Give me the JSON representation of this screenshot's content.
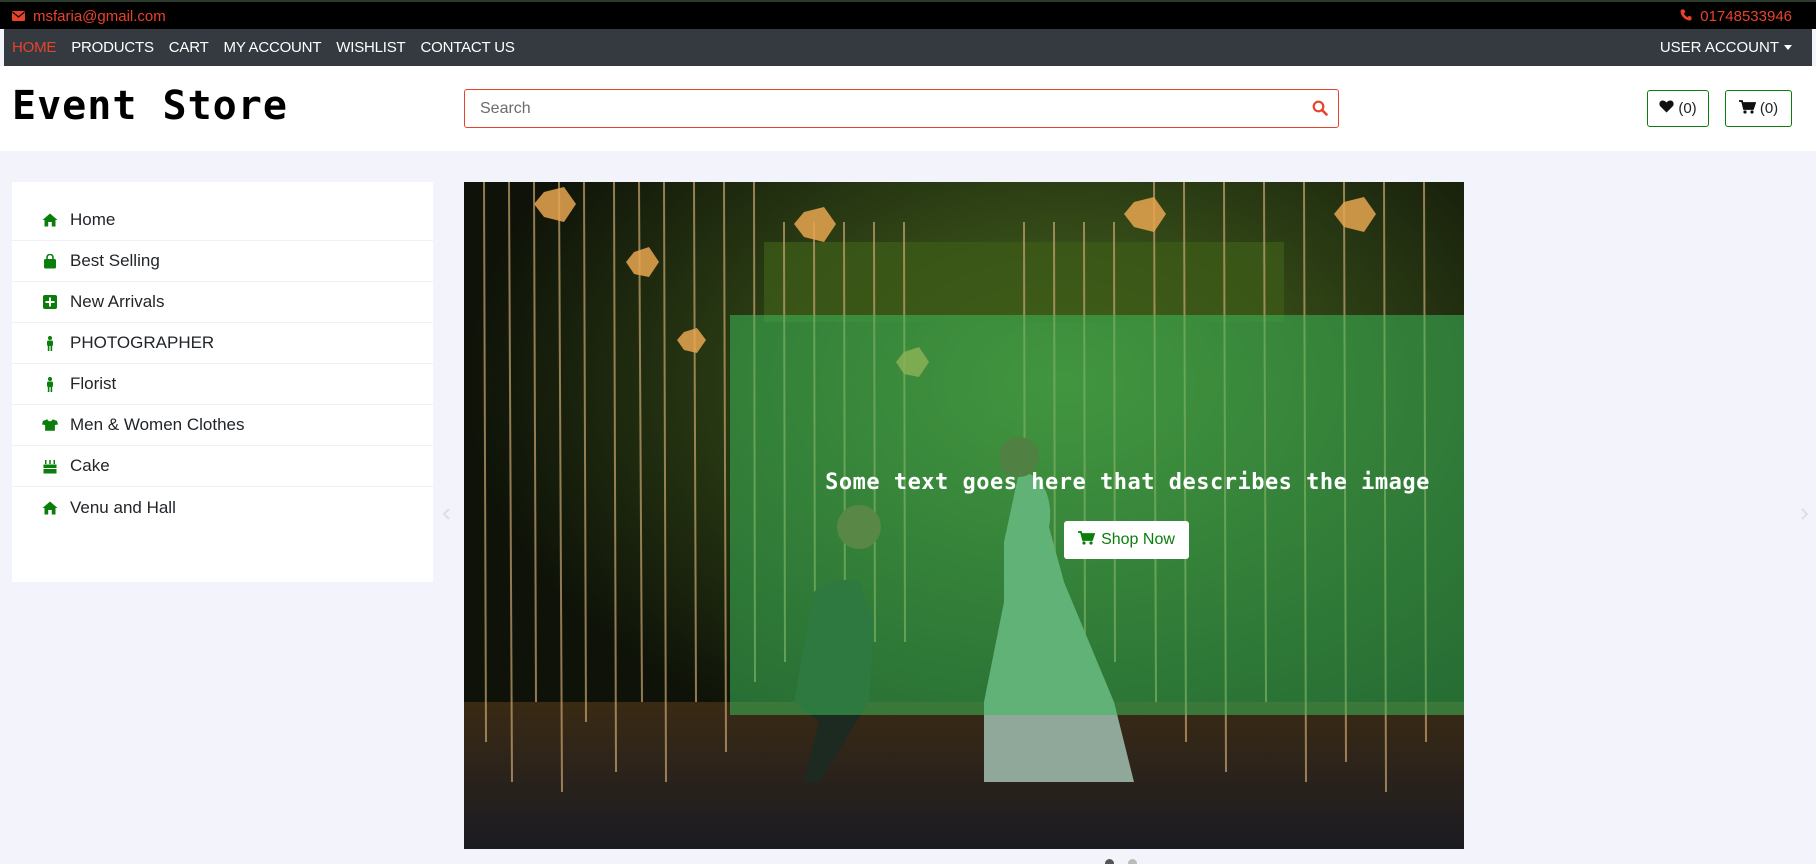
{
  "topbar": {
    "email": "msfaria@gmail.com",
    "phone": "01748533946"
  },
  "nav": {
    "items": [
      "HOME",
      "PRODUCTS",
      "CART",
      "MY ACCOUNT",
      "WISHLIST",
      "CONTACT US"
    ],
    "active_index": 0,
    "user_account": "USER ACCOUNT"
  },
  "header": {
    "logo": "Event Store",
    "search_placeholder": "Search",
    "wishlist_count": "(0)",
    "cart_count": "(0)"
  },
  "sidebar": {
    "items": [
      {
        "label": "Home",
        "icon": "home-icon"
      },
      {
        "label": "Best Selling",
        "icon": "shopping-bag-icon"
      },
      {
        "label": "New Arrivals",
        "icon": "plus-square-icon"
      },
      {
        "label": "PHOTOGRAPHER",
        "icon": "person-icon"
      },
      {
        "label": "Florist",
        "icon": "person-icon"
      },
      {
        "label": "Men & Women Clothes",
        "icon": "tshirt-icon"
      },
      {
        "label": "Cake",
        "icon": "cake-icon"
      },
      {
        "label": "Venu and Hall",
        "icon": "home-icon"
      }
    ]
  },
  "carousel": {
    "caption": "Some text goes here that describes the image",
    "button_label": "Shop Now",
    "slide_count": 2,
    "active_slide": 0
  },
  "colors": {
    "accent_red": "#e8432a",
    "brand_green": "#0b7d0b",
    "navbar_bg": "#343a40",
    "overlay_green": "rgba(60,185,90,0.55)"
  }
}
